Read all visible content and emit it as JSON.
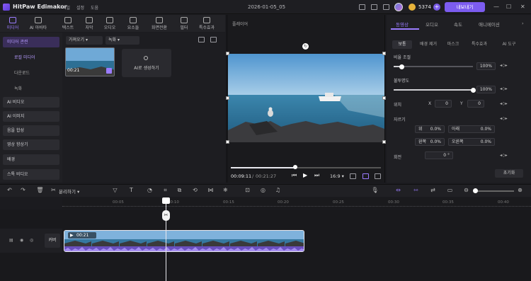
{
  "app": {
    "name": "HitPaw Edimakor",
    "menu": [
      "파일",
      "설정",
      "도움"
    ],
    "project_title": "2026-01-05_05",
    "credits": "5374",
    "export_label": "내보내기"
  },
  "tools": [
    {
      "label": "미디어",
      "icon": "media-icon"
    },
    {
      "label": "AI 아바타",
      "icon": "avatar-icon"
    },
    {
      "label": "텍스트",
      "icon": "text-icon"
    },
    {
      "label": "자막",
      "icon": "subtitle-icon"
    },
    {
      "label": "오디오",
      "icon": "audio-icon"
    },
    {
      "label": "요소들",
      "icon": "elements-icon"
    },
    {
      "label": "화면전환",
      "icon": "transition-icon"
    },
    {
      "label": "필터",
      "icon": "filter-icon"
    },
    {
      "label": "특수효과",
      "icon": "effects-icon"
    }
  ],
  "sidebar": {
    "items": [
      {
        "label": "미디어 관련"
      },
      {
        "label": "AI 비디오"
      },
      {
        "label": "AI 이미지"
      },
      {
        "label": "음을 합성"
      },
      {
        "label": "영상 향상기"
      },
      {
        "label": "배경"
      },
      {
        "label": "스톡 비디오"
      }
    ],
    "sub": [
      "로컬 미디어",
      "다운로드",
      "녹화"
    ]
  },
  "media": {
    "import_label": "가져오기",
    "record_label": "녹화",
    "clip_duration": "00:21",
    "ai_generate_label": "AI로 생성하기"
  },
  "player": {
    "title": "플레이어",
    "current_time": "00:09:11",
    "total_time": "00:21:27",
    "aspect": "16:9",
    "progress": 0.43
  },
  "props": {
    "tabs": [
      "동영상",
      "오디오",
      "속도",
      "애니메이션"
    ],
    "subtabs": [
      "보통",
      "배경 제거",
      "마스크",
      "특수효과",
      "AI 도구"
    ],
    "opacity_label": "비율 조절",
    "opacity_value": "100%",
    "opacity_level": 0.1,
    "blend_label": "불투명도",
    "blend_value": "100%",
    "blend_level": 1.0,
    "position_label": "위치",
    "pos_x_label": "X",
    "pos_x": "0",
    "pos_y_label": "Y",
    "pos_y": "0",
    "crop_label": "자르기",
    "crop": [
      {
        "label": "위",
        "value": "0.0%"
      },
      {
        "label": "아래",
        "value": "0.0%"
      },
      {
        "label": "왼쪽",
        "value": "0.0%"
      },
      {
        "label": "오른쪽",
        "value": "0.0%"
      }
    ],
    "rotate_label": "회전",
    "rotate_value": "0 °",
    "reset_label": "초기화"
  },
  "timeline": {
    "split_label": "분리하기",
    "ticks": [
      "00:05",
      "00:10",
      "00:15",
      "00:20",
      "00:25",
      "00:30",
      "00:35",
      "00:40"
    ],
    "track_label": "커버",
    "clip_duration": "00:21"
  }
}
